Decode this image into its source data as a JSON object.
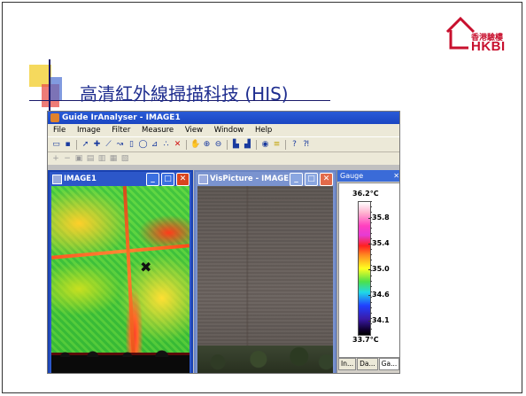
{
  "logo": {
    "zh_text": "香港驗樓",
    "en_text": "HKBI"
  },
  "slide": {
    "title": "高清紅外線掃描科技 (HIS)"
  },
  "app": {
    "title": "Guide IrAnalyser - IMAGE1",
    "menu": [
      "File",
      "Image",
      "Filter",
      "Measure",
      "View",
      "Window",
      "Help"
    ],
    "toolbar": [
      "open-icon",
      "save-icon",
      "pointer-icon",
      "spot-icon",
      "line-icon",
      "polyline-icon",
      "rect-icon",
      "ellipse-icon",
      "polygon-icon",
      "isotherm-icon",
      "delete-icon",
      "hand-icon",
      "zoom-in-icon",
      "zoom-out-icon",
      "palette-icon",
      "histogram-icon",
      "play-icon",
      "levels-icon",
      "help-icon",
      "whats-this-icon"
    ],
    "toolbar2": [
      "add-icon",
      "minus-icon",
      "copy-icon",
      "paste-icon",
      "cut-icon",
      "export-icon",
      "print-icon"
    ]
  },
  "windows": {
    "image1": {
      "title": "IMAGE1",
      "marker": "✖"
    },
    "vis": {
      "title": "VisPicture - IMAGE1"
    }
  },
  "gauge": {
    "title": "Gauge",
    "top_label": "36.2°C",
    "bottom_label": "33.7°C",
    "ticks": [
      "35.8",
      "35.4",
      "35.0",
      "34.6",
      "34.1"
    ],
    "tabs": [
      "In...",
      "Da...",
      "Ga..."
    ]
  },
  "colors": {
    "title_blue": "#1e2d8f",
    "logo_red": "#c8102e",
    "xp_blue": "#2a5bd7"
  }
}
